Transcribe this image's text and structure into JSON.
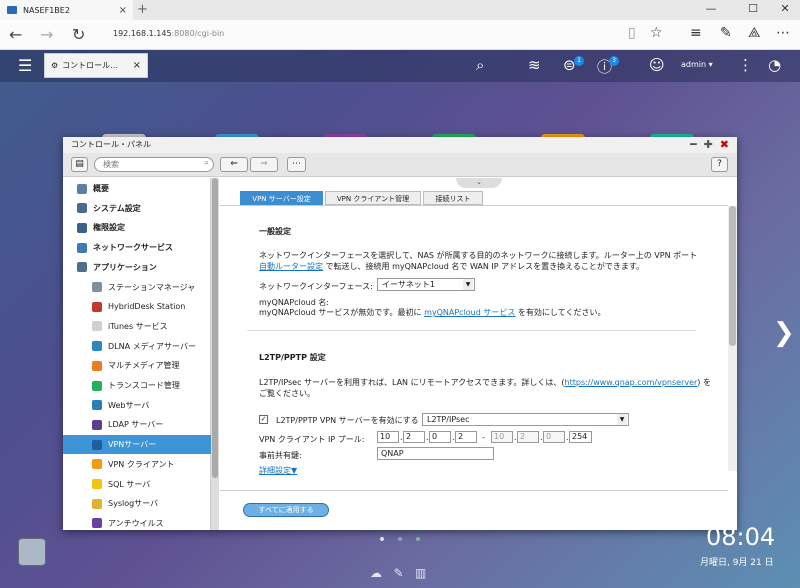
{
  "browser": {
    "tab_title": "NASEF1BE2",
    "url_host": "192.168.1.145",
    "url_path": ":8080/cgi-bin",
    "new_tab": "+",
    "close": "×",
    "min": "—",
    "max": "☐",
    "win_close": "✕"
  },
  "nasbar": {
    "tab_title": "コントロール…",
    "badge1": "1",
    "badge2": "3",
    "user": "admin ▾"
  },
  "window": {
    "title": "コントロール・パネル",
    "search_placeholder": "検索",
    "help": "?"
  },
  "sidebar": [
    {
      "label": "概要",
      "type": "top",
      "color": "#5b7fa8"
    },
    {
      "label": "システム設定",
      "type": "top",
      "color": "#4a6b8a"
    },
    {
      "label": "権限設定",
      "type": "top",
      "color": "#3b5f88"
    },
    {
      "label": "ネットワークサービス",
      "type": "top",
      "color": "#3d7ab8"
    },
    {
      "label": "アプリケーション",
      "type": "top",
      "color": "#4e6e90"
    },
    {
      "label": "ステーションマネージャ",
      "type": "sub",
      "color": "#7e8fa0"
    },
    {
      "label": "HybridDesk Station",
      "type": "sub",
      "color": "#c0392b"
    },
    {
      "label": "iTunes サービス",
      "type": "sub",
      "color": "#d0d0d0"
    },
    {
      "label": "DLNA メディアサーバー",
      "type": "sub",
      "color": "#2e86c1"
    },
    {
      "label": "マルチメディア管理",
      "type": "sub",
      "color": "#e67e22"
    },
    {
      "label": "トランスコード管理",
      "type": "sub",
      "color": "#27ae60"
    },
    {
      "label": "Webサーバ",
      "type": "sub",
      "color": "#2980b9"
    },
    {
      "label": "LDAP サーバー",
      "type": "sub",
      "color": "#5d3f8f"
    },
    {
      "label": "VPNサーバー",
      "type": "sub",
      "color": "#1f5f9f",
      "selected": true
    },
    {
      "label": "VPN クライアント",
      "type": "sub",
      "color": "#f39c12"
    },
    {
      "label": "SQL サーバ",
      "type": "sub",
      "color": "#f1c40f"
    },
    {
      "label": "Syslogサーバ",
      "type": "sub",
      "color": "#e0b030"
    },
    {
      "label": "アンチウイルス",
      "type": "sub",
      "color": "#6c3fa0"
    }
  ],
  "tabs": [
    "VPN サーバー設定",
    "VPN クライアント管理",
    "接続リスト"
  ],
  "content": {
    "general_title": "一般設定",
    "general_desc1": "ネットワークインターフェースを選択して、NAS が所属する目的のネットワークに接続します。ルーター上の VPN ポート",
    "general_desc2_link": "自動ルーター設定",
    "general_desc2_rest": "で転送し、接続用 myQNAPcloud 名で WAN IP アドレスを置き換えることができます。",
    "nic_label": "ネットワークインターフェース:",
    "nic_value": "イーサネット1",
    "mqc_name": "myQNAPcloud 名:",
    "mqc_status_pre": "myQNAPcloud サービスが無効です。最初に",
    "mqc_link": "myQNAPcloud サービス",
    "mqc_status_post": "を有効にしてください。",
    "l2tp_title": "L2TP/PPTP 設定",
    "l2tp_desc1_pre": "L2TP/IPsec サーバーを利用すれば、LAN にリモートアクセスできます。詳しくは、(",
    "l2tp_link": "https://www.qnap.com/vpnserver",
    "l2tp_desc1_post": ") を",
    "l2tp_desc2": "ご覧ください。",
    "enable_label": "L2TP/PPTP VPN サーバーを有効にする",
    "enable_value": "L2TP/IPsec",
    "ip_pool_label": "VPN クライアント IP プール:",
    "ip_start": [
      "10",
      "2",
      "0",
      "2"
    ],
    "ip_end": [
      "10",
      "2",
      "0",
      "254"
    ],
    "psk_label": "事前共有鍵:",
    "psk_value": "QNAP",
    "advanced": "詳細設定▼",
    "apply_all": "すべてに適用する"
  },
  "desktop": {
    "clock": "08:04",
    "date": "月曜日, 9月 21 日"
  }
}
